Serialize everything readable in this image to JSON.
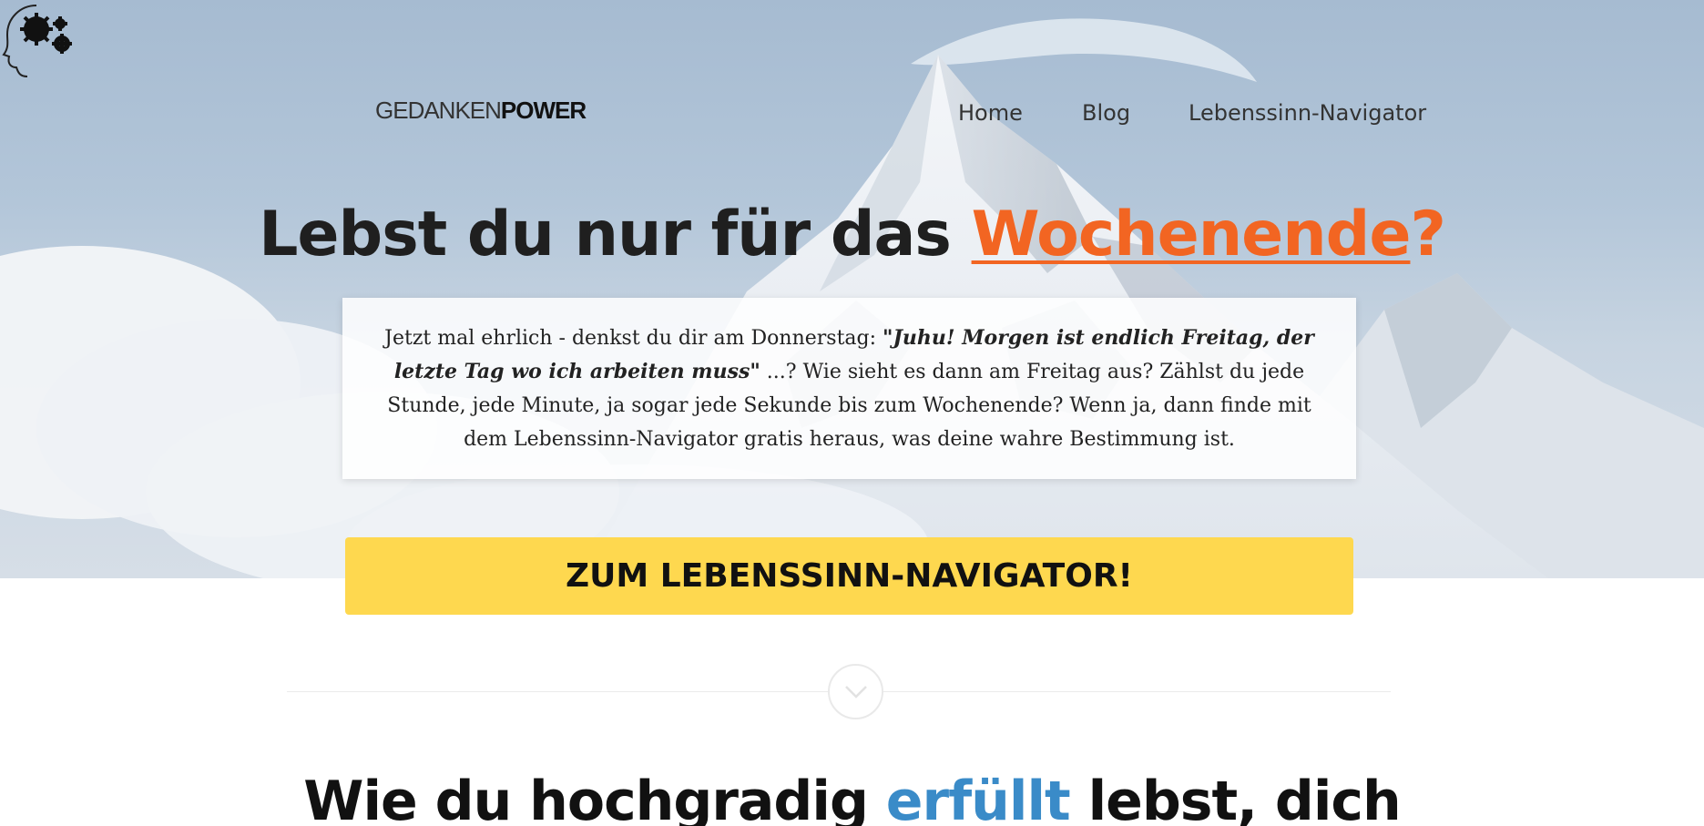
{
  "brand": {
    "name_light": "GEDANKEN",
    "name_bold": "POWER",
    "logo_icon": "head-with-gears-icon"
  },
  "nav": {
    "items": [
      {
        "label": "Home"
      },
      {
        "label": "Blog"
      },
      {
        "label": "Lebenssinn-Navigator"
      }
    ]
  },
  "hero": {
    "headline_prefix": "Lebst du nur für das ",
    "headline_accent": "Wochenende",
    "headline_suffix": "?",
    "intro": {
      "part1": "Jetzt mal ehrlich - denkst du dir am Donnerstag: ",
      "quote": "\"Juhu! Morgen ist endlich Freitag, der letzte Tag wo ich arbeiten muss\"",
      "part2": " ...? Wie sieht es dann am Freitag aus? Zählst du jede Stunde, jede Minute, ja sogar jede Sekunde bis zum Wochenende? Wenn ja, dann finde mit dem Lebenssinn-Navigator gratis heraus, was deine wahre Bestimmung ist."
    },
    "cta_label": "ZUM LEBENSSINN-NAVIGATOR!"
  },
  "divider": {
    "icon": "chevron-down-icon"
  },
  "section": {
    "title_prefix": "Wie du hochgradig ",
    "title_accent": "erfüllt",
    "title_suffix": " lebst, dich"
  },
  "colors": {
    "accent_orange": "#f26522",
    "cta_yellow": "#fed84f",
    "accent_blue": "#3a8bc8",
    "text_dark": "#1f1f1f"
  }
}
